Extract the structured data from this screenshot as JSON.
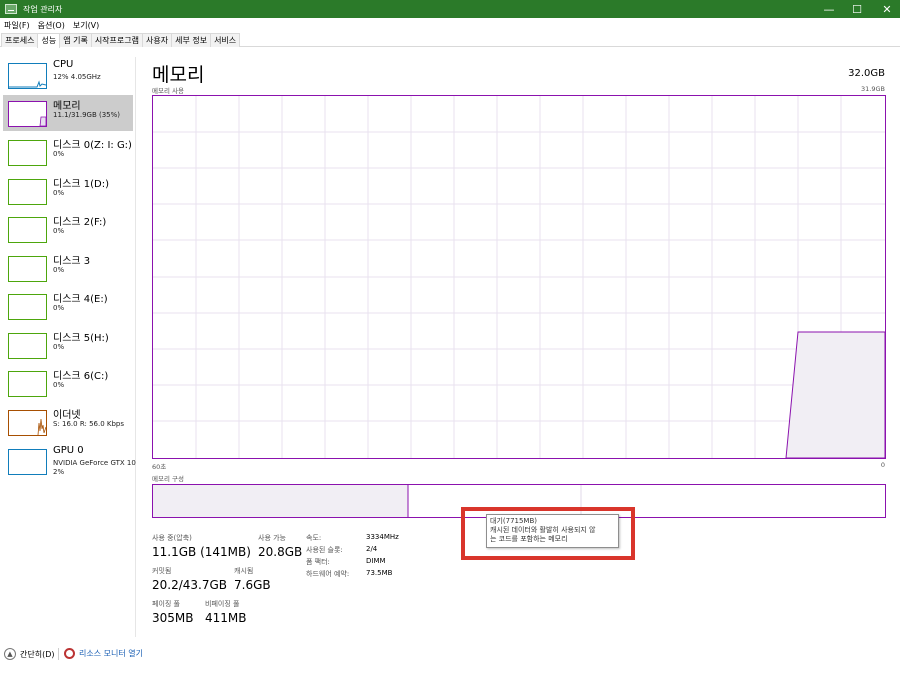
{
  "window": {
    "title": "작업 관리자",
    "controls": {
      "minimize": "—",
      "maximize": "☐",
      "close": "✕"
    }
  },
  "menu": [
    "파일(F)",
    "옵션(O)",
    "보기(V)"
  ],
  "tabs": [
    "프로세스",
    "성능",
    "앱 기록",
    "시작프로그램",
    "사용자",
    "세부 정보",
    "서비스"
  ],
  "sidebar": [
    {
      "title": "CPU",
      "sub": "12% 4.05GHz",
      "kind": "cpu"
    },
    {
      "title": "메모리",
      "sub": "11.1/31.9GB (35%)",
      "kind": "mem"
    },
    {
      "title": "디스크 0(Z: I: G:)",
      "sub": "0%",
      "kind": "disk"
    },
    {
      "title": "디스크 1(D:)",
      "sub": "0%",
      "kind": "disk"
    },
    {
      "title": "디스크 2(F:)",
      "sub": "0%",
      "kind": "disk"
    },
    {
      "title": "디스크 3",
      "sub": "0%",
      "kind": "disk"
    },
    {
      "title": "디스크 4(E:)",
      "sub": "0%",
      "kind": "disk"
    },
    {
      "title": "디스크 5(H:)",
      "sub": "0%",
      "kind": "disk"
    },
    {
      "title": "디스크 6(C:)",
      "sub": "0%",
      "kind": "disk"
    },
    {
      "title": "이더넷",
      "sub": "S: 16.0 R: 56.0 Kbps",
      "kind": "eth"
    },
    {
      "title": "GPU 0",
      "sub": "NVIDIA GeForce GTX 10",
      "sub2": "2%",
      "kind": "gpu"
    }
  ],
  "main": {
    "title": "메모리",
    "total": "32.0GB",
    "usage_label": "메모리 사용",
    "usage_max": "31.9GB",
    "axis_left": "60초",
    "axis_right": "0",
    "composition_label": "메모리 구성",
    "usage_fraction": 0.35,
    "stats": {
      "in_use_label": "사용 중(압축)",
      "in_use": "11.1GB (141MB)",
      "available_label": "사용 가능",
      "available": "20.8GB",
      "committed_label": "커밋됨",
      "committed": "20.2/43.7GB",
      "cached_label": "캐시됨",
      "cached": "7.6GB",
      "paged_label": "페이징 풀",
      "paged": "305MB",
      "nonpaged_label": "비페이징 풀",
      "nonpaged": "411MB"
    },
    "specs": {
      "speed_label": "속도:",
      "speed": "3334MHz",
      "slots_label": "사용된 슬롯:",
      "slots": "2/4",
      "form_label": "폼 팩터:",
      "form": "DIMM",
      "reserved_label": "하드웨어 예약:",
      "reserved": "73.5MB"
    },
    "tooltip": {
      "line1": "대기(7715MB)",
      "line2": "캐시된 데이터와 활발히 사용되지 않",
      "line3": "는 코드를 포함하는 메모리"
    }
  },
  "footer": {
    "fewer": "간단히(D)",
    "resmon": "리소스 모니터 열기"
  },
  "colors": {
    "title_bar": "#2b7a29",
    "memory": "#8b12ae",
    "disk": "#4da60c",
    "cpu": "#117dbb",
    "ethernet": "#a74f01",
    "highlight": "#d9352b"
  }
}
